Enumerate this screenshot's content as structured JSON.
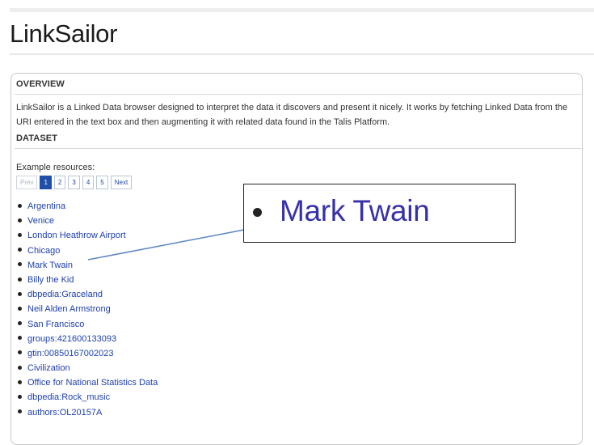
{
  "page": {
    "title": "LinkSailor"
  },
  "overview": {
    "heading": "OVERVIEW",
    "text": "LinkSailor is a Linked Data browser designed to interpret the data it discovers and present it nicely. It works by fetching Linked Data from the URI entered in the text box and then augmenting it with related data found in the Talis Platform."
  },
  "dataset": {
    "heading": "DATASET",
    "example_label": "Example resources:",
    "pager": {
      "prev": "Prev",
      "pages": [
        "1",
        "2",
        "3",
        "4",
        "5"
      ],
      "active_page": "1",
      "next": "Next"
    },
    "resources": [
      "Argentina",
      "Venice",
      "London Heathrow Airport",
      "Chicago",
      "Mark Twain",
      "Billy the Kid",
      "dbpedia:Graceland",
      "Neil Alden Armstrong",
      "San Francisco",
      "groups:421600133093",
      "gtin:00850167002023",
      "Civilization",
      "Office for National Statistics Data",
      "dbpedia:Rock_music",
      "authors:OL20157A"
    ]
  },
  "callout": {
    "text": "Mark Twain"
  },
  "colors": {
    "link": "#1d3fb0",
    "callout_text": "#3731a8",
    "pager_active": "#1f4fa8",
    "connector": "#5b86c5"
  }
}
